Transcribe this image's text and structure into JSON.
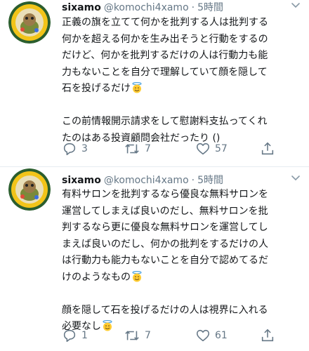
{
  "tweets": [
    {
      "name": "sixamo",
      "handle": "@komochi4xamo",
      "time": "5時間",
      "lines": [
        "正義の旗を立てて何かを批判する人は批判する",
        "何かを超える何かを生み出そうと行動をするの",
        "だけど、何かを批判するだけの人は行動力も能",
        "力もないことを自分で理解していて顔を隠して",
        "石を投げるだけ",
        "",
        "この前情報開示請求をして慰謝料支払ってくれ",
        "たのはある投資顧問会社だったり ()"
      ],
      "replies": "3",
      "retweets": "7",
      "likes": "57"
    },
    {
      "name": "sixamo",
      "handle": "@komochi4xamo",
      "time": "5時間",
      "lines": [
        "有料サロンを批判するなら優良な無料サロンを",
        "運営してしまえば良いのだし、無料サロンを批",
        "判するなら更に優良な無料サロンを運営してし",
        "まえば良いのだし、何かの批判をするだけの人",
        "は行動力も能力もないことを自分で認めてるだ",
        "けのようなもの",
        "",
        "顔を隠して石を投げるだけの人は視界に入れる",
        "必要なし"
      ],
      "replies": "1",
      "retweets": "7",
      "likes": "61"
    }
  ],
  "colors": {
    "text": "#14171a",
    "muted": "#657786",
    "divider": "#e6ecf0"
  },
  "icons": [
    "reply-icon",
    "retweet-icon",
    "like-icon",
    "share-icon",
    "chevron-down-icon",
    "smiling-face-with-halo-emoji"
  ]
}
